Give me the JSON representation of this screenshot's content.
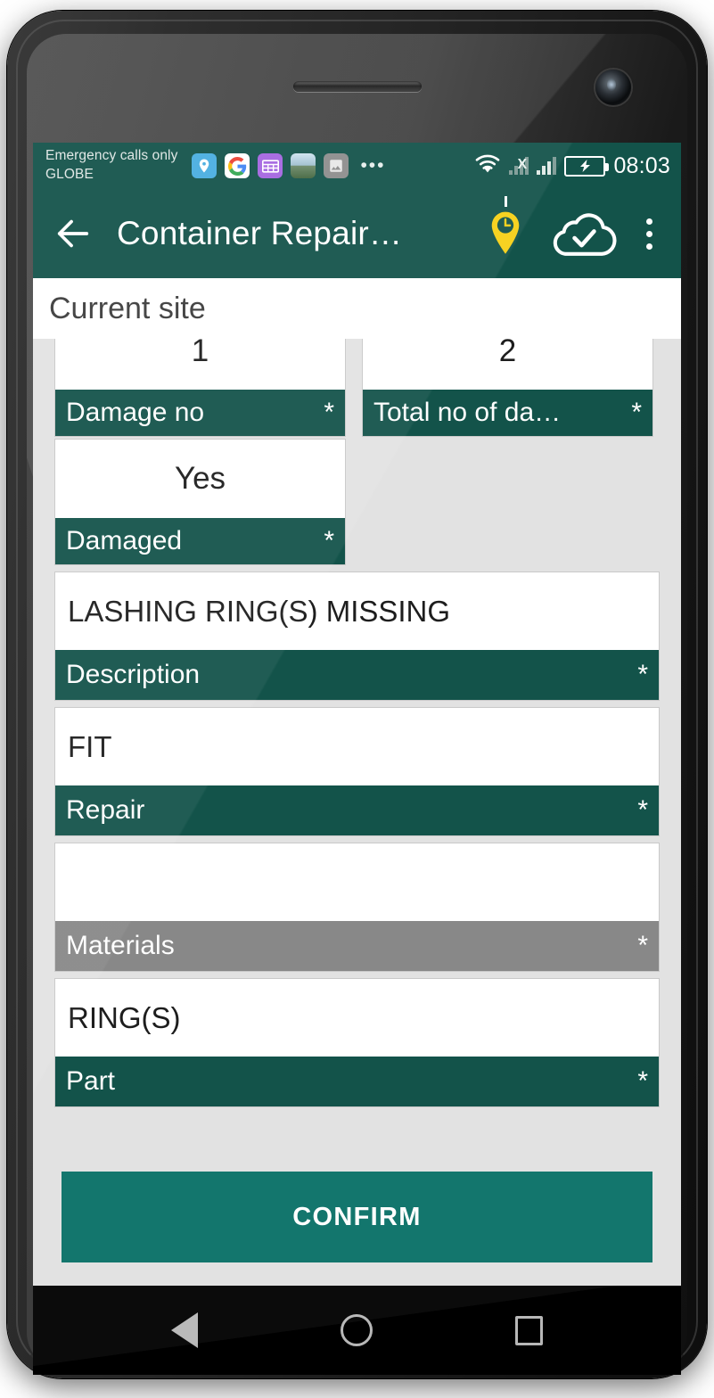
{
  "status_bar": {
    "carrier": "Emergency calls only\nGLOBE",
    "google_letter": "G",
    "overflow_dots": "•••",
    "time": "08:03",
    "icons": [
      "location-pin-icon",
      "google-icon",
      "sheets-icon",
      "photo-thumbnail-icon",
      "gallery-icon"
    ],
    "right_icons": [
      "wifi-icon",
      "signal-no-service-icon",
      "signal-icon",
      "battery-charging-icon"
    ],
    "no_service_mark": "X"
  },
  "app_bar": {
    "title": "Container Repair…",
    "back_icon": "arrow-back-icon",
    "pin_icon": "location-clock-pin-icon",
    "cloud_icon": "cloud-done-icon",
    "menu_icon": "overflow-menu-icon"
  },
  "banner": {
    "title": "Current site"
  },
  "form": {
    "required_marker": "*",
    "row_fields": [
      {
        "value": "1",
        "label": "Damage no",
        "required": true,
        "state": "enabled"
      },
      {
        "value": "2",
        "label": "Total no of da…",
        "required": true,
        "state": "enabled"
      }
    ],
    "fields": [
      {
        "value": "Yes",
        "label": "Damaged",
        "required": true,
        "state": "enabled"
      },
      {
        "value": "LASHING RING(S) MISSING",
        "label": "Description",
        "required": true,
        "state": "enabled"
      },
      {
        "value": "FIT",
        "label": "Repair",
        "required": true,
        "state": "enabled"
      },
      {
        "value": "",
        "label": "Materials",
        "required": true,
        "state": "disabled"
      },
      {
        "value": "RING(S)",
        "label": "Part",
        "required": true,
        "state": "enabled"
      }
    ]
  },
  "actions": {
    "confirm_label": "CONFIRM"
  },
  "nav_bar": {
    "back": "nav-back-icon",
    "home": "nav-home-icon",
    "recents": "nav-recents-icon"
  },
  "colors": {
    "primary_teal": "#13534a",
    "confirm_teal": "#13766d",
    "disabled_gray": "#888888",
    "screen_bg": "#e2e2e2",
    "pin_yellow": "#f7cf15"
  }
}
